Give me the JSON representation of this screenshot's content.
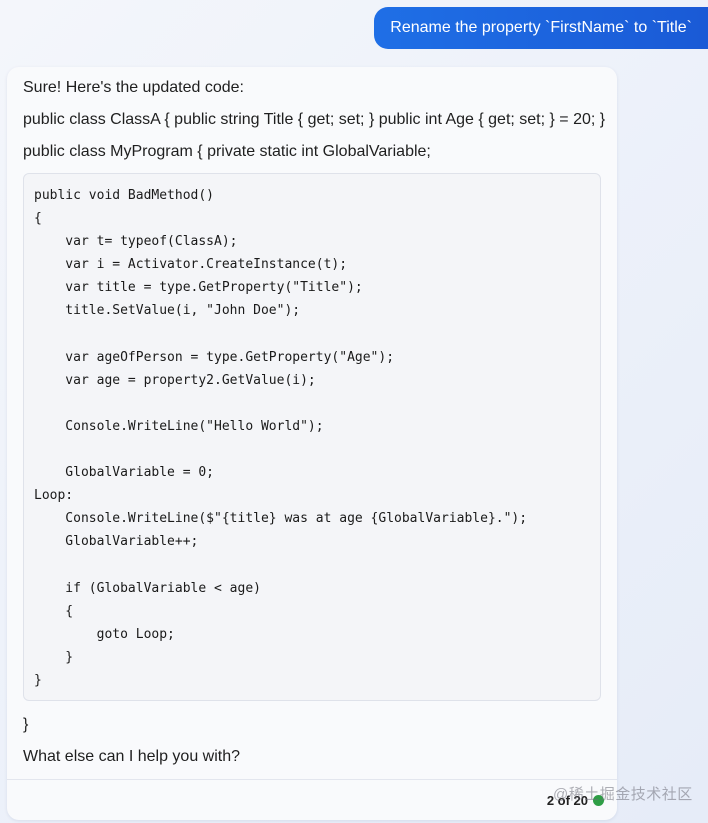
{
  "user_message": {
    "text": "Rename the property `FirstName` to `Title`"
  },
  "assistant_message": {
    "intro": "Sure! Here's the updated code:",
    "line_class_a": "public class ClassA { public string Title { get; set; } public int Age { get; set; } = 20; }",
    "line_my_program": "public class MyProgram { private static int GlobalVariable;",
    "code": "public void BadMethod()\n{\n    var t= typeof(ClassA);\n    var i = Activator.CreateInstance(t);\n    var title = type.GetProperty(\"Title\");\n    title.SetValue(i, \"John Doe\");\n\n    var ageOfPerson = type.GetProperty(\"Age\");\n    var age = property2.GetValue(i);\n\n    Console.WriteLine(\"Hello World\");\n\n    GlobalVariable = 0;\nLoop:\n    Console.WriteLine($\"{title} was at age {GlobalVariable}.\");\n    GlobalVariable++;\n\n    if (GlobalVariable < age)\n    {\n        goto Loop;\n    }\n}",
    "closing_brace": "}",
    "follow_up": "What else can I help you with?"
  },
  "footer": {
    "page_count": "2 of 20",
    "status_color": "#2e9e45"
  },
  "watermark": {
    "text": "@稀土掘金技术社区"
  },
  "colors": {
    "accent": "#1f6fe6",
    "card_background": "#f9fafc",
    "code_background": "#f4f5f8"
  }
}
